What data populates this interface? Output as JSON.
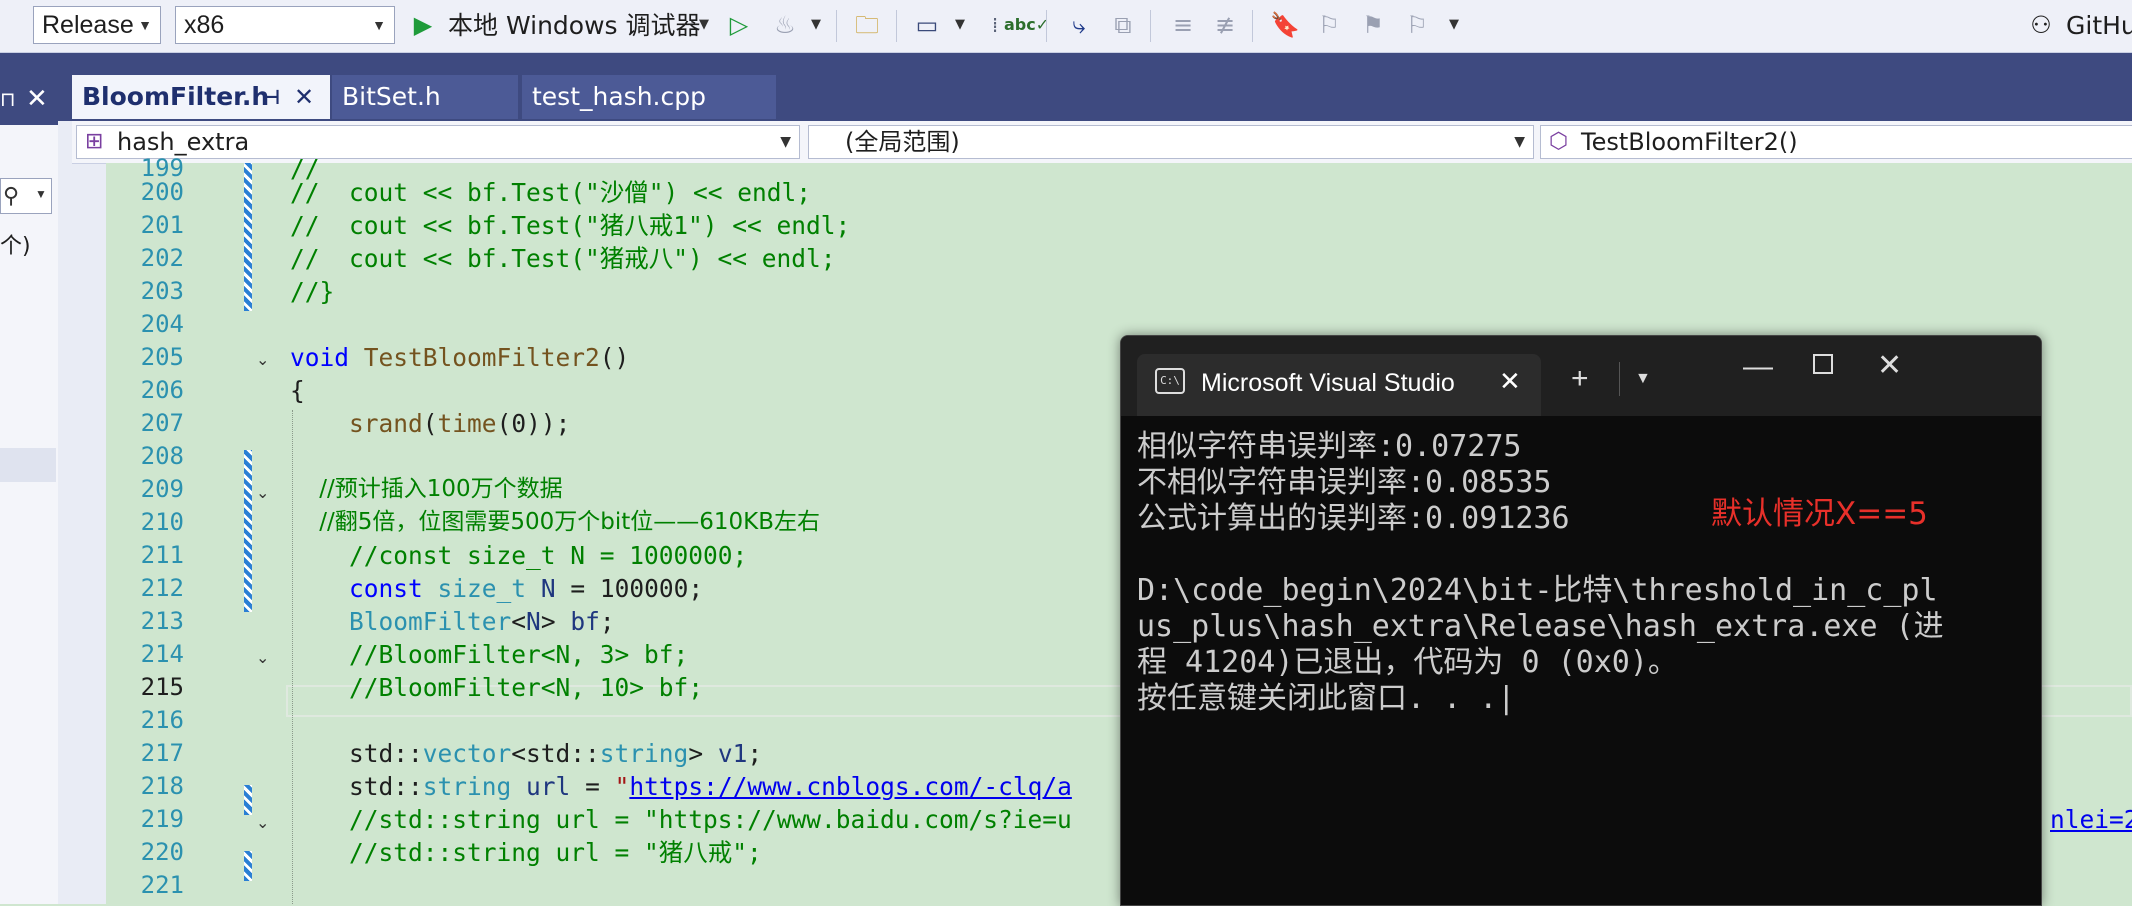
{
  "toolbar": {
    "config": "Release",
    "platform": "x86",
    "run_label": "本地 Windows 调试器",
    "github_label": "GitHu"
  },
  "tabs": [
    {
      "label": "BloomFilter.h",
      "active": true
    },
    {
      "label": "BitSet.h",
      "active": false
    },
    {
      "label": "test_hash.cpp",
      "active": false
    }
  ],
  "left_panel": {
    "snippet": "个)"
  },
  "navbar": {
    "project": "hash_extra",
    "scope": "(全局范围)",
    "member": "TestBloomFilter2()"
  },
  "editor": {
    "current_line": "215",
    "lines": [
      {
        "num": "199",
        "text": "//"
      },
      {
        "num": "200",
        "text": "//  cout << bf.Test(\"沙僧\") << endl;"
      },
      {
        "num": "201",
        "text": "//  cout << bf.Test(\"猪八戒1\") << endl;"
      },
      {
        "num": "202",
        "text": "//  cout << bf.Test(\"猪戒八\") << endl;"
      },
      {
        "num": "203",
        "text": "//}"
      },
      {
        "num": "204",
        "text": ""
      },
      {
        "num": "205",
        "text": "void TestBloomFilter2()"
      },
      {
        "num": "206",
        "text": "{"
      },
      {
        "num": "207",
        "text": "    srand(time(0));"
      },
      {
        "num": "208",
        "text": ""
      },
      {
        "num": "209",
        "text": "    //预计插入100万个数据"
      },
      {
        "num": "210",
        "text": "    //翻5倍，位图需要500万个bit位——610KB左右"
      },
      {
        "num": "211",
        "text": "    //const size_t N = 1000000;"
      },
      {
        "num": "212",
        "text": "    const size_t N = 100000;"
      },
      {
        "num": "213",
        "text": "    BloomFilter<N> bf;"
      },
      {
        "num": "214",
        "text": "    //BloomFilter<N, 3> bf;"
      },
      {
        "num": "215",
        "text": "    //BloomFilter<N, 10> bf;"
      },
      {
        "num": "216",
        "text": ""
      },
      {
        "num": "217",
        "text": "    std::vector<std::string> v1;"
      },
      {
        "num": "218",
        "text": "    std::string url = \"https://www.cnblogs.com/-clq/a"
      },
      {
        "num": "219",
        "text": "    //std::string url = \"https://www.baidu.com/s?ie=u"
      },
      {
        "num": "220",
        "text": "    //std::string url = \"猪八戒\";"
      },
      {
        "num": "221",
        "text": ""
      }
    ],
    "overflow_link": "nlei=2"
  },
  "console": {
    "title": "Microsoft Visual Studio",
    "lines": [
      "相似字符串误判率:0.07275",
      "不相似字符串误判率:0.08535",
      "公式计算出的误判率:0.091236",
      "",
      "D:\\code_begin\\2024\\bit-比特\\threshold_in_c_pl",
      "us_plus\\hash_extra\\Release\\hash_extra.exe (进",
      "程 41204)已退出，代码为 0 (0x0)。",
      "按任意键关闭此窗口. . .|"
    ],
    "annotation": "默认情况X==5"
  },
  "icons": [
    "run-icon",
    "run-no-debug-icon",
    "hot-reload-icon",
    "folder-search-icon",
    "layout-icon",
    "spellcheck-icon",
    "format-icon",
    "bookmark-icon",
    "github-icon",
    "terminal-icon",
    "close-icon",
    "plus-icon",
    "chevron-down-icon",
    "minimize-icon",
    "maximize-icon",
    "pin-icon",
    "search-icon",
    "cube-icon"
  ]
}
